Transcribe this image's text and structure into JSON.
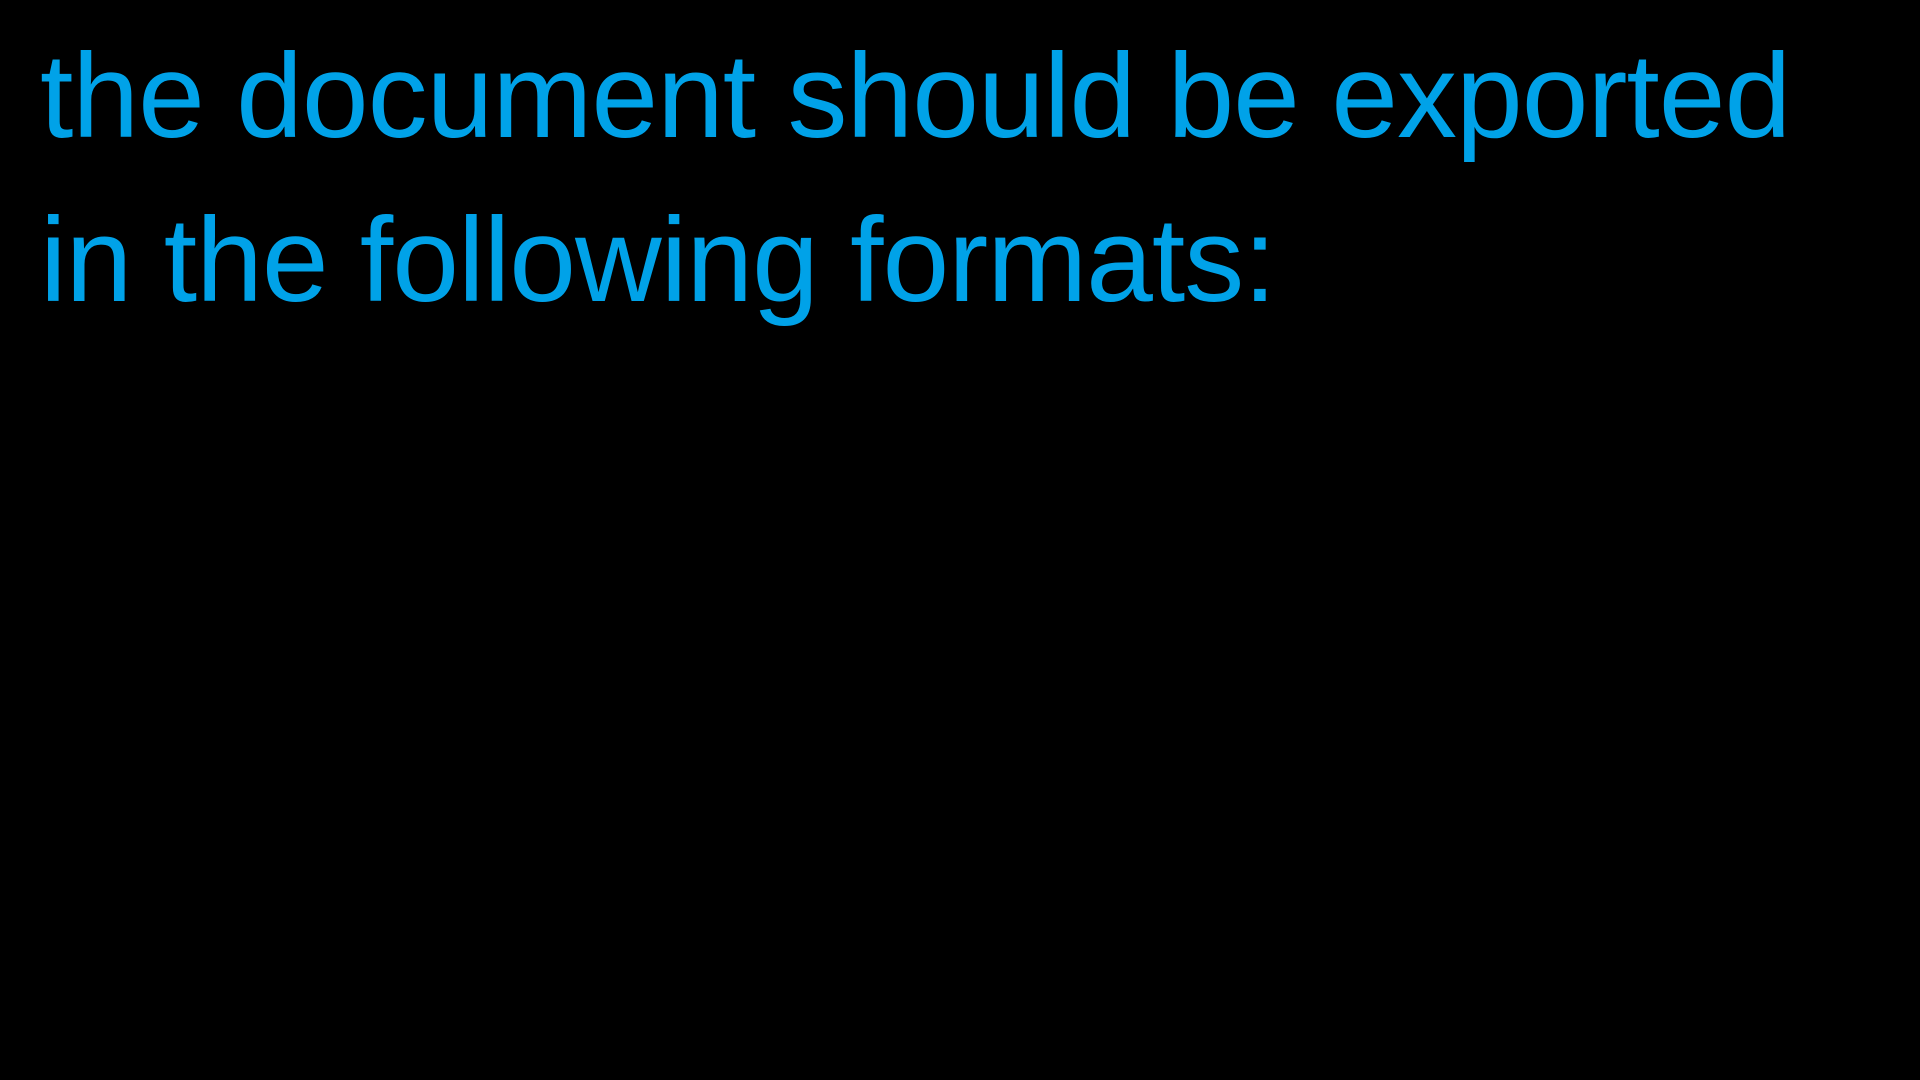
{
  "slide": {
    "lines": [
      "the document should be exported",
      "in the following formats:"
    ]
  },
  "colors": {
    "background": "#000000",
    "text": "#00A2E8"
  }
}
